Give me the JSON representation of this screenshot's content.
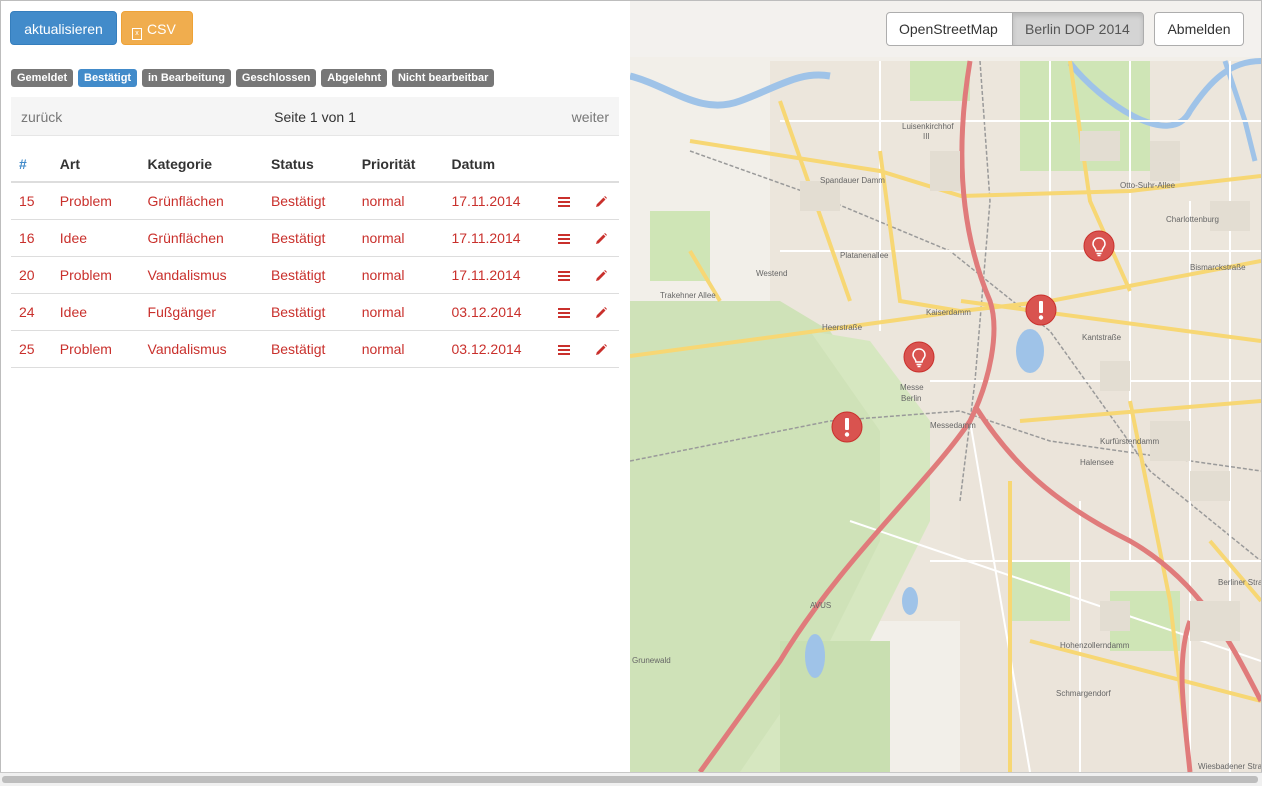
{
  "toolbar": {
    "refresh_label": "aktualisieren",
    "csv_label": "CSV",
    "csv_icon": "file-excel-icon"
  },
  "status_filters": [
    {
      "label": "Gemeldet",
      "active": false
    },
    {
      "label": "Bestätigt",
      "active": true
    },
    {
      "label": "in Bearbeitung",
      "active": false
    },
    {
      "label": "Geschlossen",
      "active": false
    },
    {
      "label": "Abgelehnt",
      "active": false
    },
    {
      "label": "Nicht bearbeitbar",
      "active": false
    }
  ],
  "pager": {
    "prev_label": "zurück",
    "info": "Seite 1 von 1",
    "next_label": "weiter"
  },
  "table": {
    "columns": [
      "#",
      "Art",
      "Kategorie",
      "Status",
      "Priorität",
      "Datum"
    ],
    "rows": [
      {
        "id": "15",
        "art": "Problem",
        "kategorie": "Grünflächen",
        "status": "Bestätigt",
        "prioritaet": "normal",
        "datum": "17.11.2014"
      },
      {
        "id": "16",
        "art": "Idee",
        "kategorie": "Grünflächen",
        "status": "Bestätigt",
        "prioritaet": "normal",
        "datum": "17.11.2014"
      },
      {
        "id": "20",
        "art": "Problem",
        "kategorie": "Vandalismus",
        "status": "Bestätigt",
        "prioritaet": "normal",
        "datum": "17.11.2014"
      },
      {
        "id": "24",
        "art": "Idee",
        "kategorie": "Fußgänger",
        "status": "Bestätigt",
        "prioritaet": "normal",
        "datum": "03.12.2014"
      },
      {
        "id": "25",
        "art": "Problem",
        "kategorie": "Vandalismus",
        "status": "Bestätigt",
        "prioritaet": "normal",
        "datum": "03.12.2014"
      }
    ]
  },
  "map": {
    "layers": [
      {
        "label": "OpenStreetMap",
        "active": false
      },
      {
        "label": "Berlin DOP 2014",
        "active": true
      }
    ],
    "logout_label": "Abmelden",
    "labels": {
      "spandauer_damm": "Spandauer Damm",
      "luisenkirchhof": "Luisenkirchhof",
      "luisenkirchhof_num": "III",
      "charlottenburg": "Charlottenburg",
      "bismarckstrasse": "Bismarckstraße",
      "kaiserdamm": "Kaiserdamm",
      "kantstrasse": "Kantstraße",
      "westend": "Westend",
      "heerstrasse": "Heerstraße",
      "messe_berlin": "Messe",
      "messe_berlin2": "Berlin",
      "halensee": "Halensee",
      "kurfuerstendamm": "Kurfürstendamm",
      "hohenzollerndamm": "Hohenzollerndamm",
      "schmargendorf": "Schmargendorf",
      "grunewald": "Grunewald",
      "berliner_strasse": "Berliner Straße",
      "trakehner_allee": "Trakehner Allee",
      "otto_suhr_allee": "Otto-Suhr-Allee",
      "wiesbadener_strasse": "Wiesbadener Straße",
      "avus": "AVUS",
      "platanenallee": "Platanenallee",
      "messedamm": "Messedamm"
    },
    "markers": [
      {
        "type": "idea",
        "icon": "lightbulb-icon"
      },
      {
        "type": "problem",
        "icon": "exclamation-icon"
      },
      {
        "type": "idea",
        "icon": "lightbulb-icon"
      },
      {
        "type": "problem",
        "icon": "exclamation-icon"
      }
    ],
    "colors": {
      "marker": "#d9534f",
      "motorway": "#e07b7b",
      "primary_road": "#f7d774",
      "water": "#9fc3e8",
      "park": "#cde5b4"
    }
  }
}
